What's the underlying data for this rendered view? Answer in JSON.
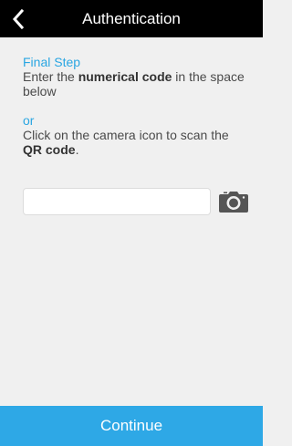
{
  "header": {
    "title": "Authentication",
    "back_icon": "chevron-left-icon"
  },
  "instructions": {
    "step_title": "Final Step",
    "line1_prefix": "Enter the ",
    "line1_bold": "numerical code",
    "line1_suffix": " in the space below",
    "or_label": "or",
    "line2_prefix": "Click on the camera icon to scan the ",
    "line2_bold": "QR code",
    "line2_suffix": "."
  },
  "code_input": {
    "value": "",
    "placeholder": ""
  },
  "camera": {
    "icon": "camera-icon"
  },
  "footer": {
    "continue_label": "Continue"
  },
  "colors": {
    "accent": "#2aa6e2",
    "header_bg": "#000000",
    "background": "#f0f0f0",
    "button_bg": "#2ea8e6"
  }
}
